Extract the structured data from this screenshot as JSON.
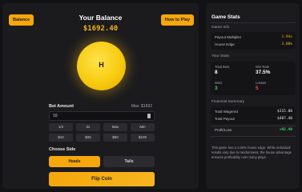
{
  "header": {
    "balance_button": "Balance",
    "title": "Your Balance",
    "balance_value": "$1692.40",
    "how_to_play_button": "How to Play"
  },
  "coin": {
    "face": "H"
  },
  "bet": {
    "label": "Bet Amount",
    "max_label": "Max: $1692",
    "input_value": "10",
    "quick_row1": [
      "1/2",
      "2x",
      "Max",
      "Min"
    ],
    "quick_row2": [
      "$10",
      "$25",
      "$50",
      "$100"
    ]
  },
  "side_choice": {
    "label": "Choose Side",
    "heads": "Heads",
    "tails": "Tails",
    "selected": "Heads"
  },
  "flip_button": "Flip Coin",
  "stats": {
    "title": "Game Stats",
    "game_info": {
      "label": "Game Info",
      "payout_label": "Payout Multiplier",
      "payout_value": "1.94x",
      "edge_label": "House Edge",
      "edge_value": "3.00%"
    },
    "your_stats": {
      "label": "Your Stats",
      "total_bets_label": "Total Bets",
      "total_bets_value": "8",
      "win_rate_label": "Win Rate",
      "win_rate_value": "37.5%",
      "wins_label": "Wins",
      "wins_value": "3",
      "losses_label": "Losses",
      "losses_value": "5"
    },
    "financial": {
      "label": "Financial Summary",
      "wagered_label": "Total Wagered",
      "wagered_value": "$315.00",
      "payout_label": "Total Payout",
      "payout_value": "$407.40",
      "pnl_label": "Profit/Loss",
      "pnl_value": "+92.40"
    },
    "note": "This game has a 3.00% house edge. While individual results vary due to randomness, the house advantage ensures profitability over many plays."
  },
  "colors": {
    "accent": "#f5a70b",
    "win": "#3ecf5a",
    "loss": "#f04a3a",
    "payout": "#f5b21a"
  }
}
